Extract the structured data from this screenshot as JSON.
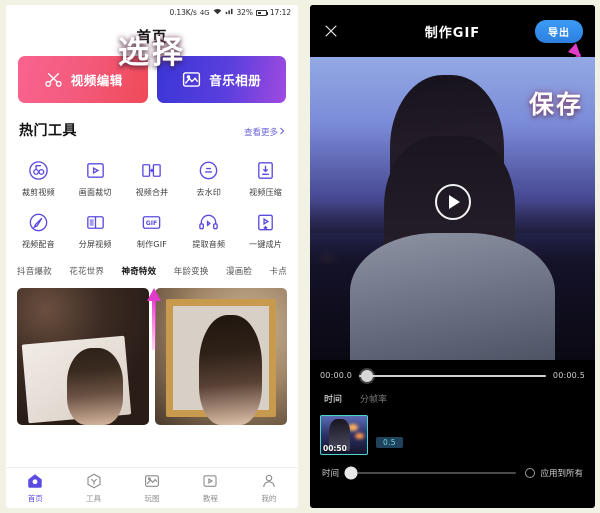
{
  "left_phone": {
    "status_bar": {
      "network_speed": "0.13K/s",
      "signal": "4G",
      "wifi_icon": "wifi-icon",
      "cell_icon": "signal-bars-icon",
      "battery_percent": "32%",
      "battery_icon": "battery-icon",
      "clock": "17:12"
    },
    "page_title": "首页",
    "hero_buttons": [
      {
        "label": "视频编辑",
        "icon": "scissors-icon",
        "color": "#f45b7e"
      },
      {
        "label": "音乐相册",
        "icon": "photo-icon",
        "color": "#5a3fdd"
      }
    ],
    "section": {
      "title": "热门工具",
      "more_label": "查看更多",
      "more_icon": "chevron-right-icon"
    },
    "tools": [
      {
        "label": "裁剪视频",
        "icon": "trim-video-icon"
      },
      {
        "label": "画面裁切",
        "icon": "crop-frame-icon"
      },
      {
        "label": "视频合并",
        "icon": "merge-video-icon"
      },
      {
        "label": "去水印",
        "icon": "remove-watermark-icon"
      },
      {
        "label": "视频压缩",
        "icon": "compress-video-icon"
      },
      {
        "label": "视频配音",
        "icon": "dubbing-icon"
      },
      {
        "label": "分屏视频",
        "icon": "split-screen-icon"
      },
      {
        "label": "制作GIF",
        "icon": "gif-icon"
      },
      {
        "label": "提取音频",
        "icon": "extract-audio-icon"
      },
      {
        "label": "一键成片",
        "icon": "one-tap-movie-icon"
      }
    ],
    "chips": [
      {
        "label": "抖音爆款",
        "active": false
      },
      {
        "label": "花花世界",
        "active": false
      },
      {
        "label": "神奇特效",
        "active": true
      },
      {
        "label": "年龄变换",
        "active": false
      },
      {
        "label": "漫画脸",
        "active": false
      },
      {
        "label": "卡点",
        "active": false
      }
    ],
    "annotation": "选择",
    "bottom_nav": [
      {
        "label": "首页",
        "icon": "home-icon",
        "active": true
      },
      {
        "label": "工具",
        "icon": "tools-icon",
        "active": false
      },
      {
        "label": "玩图",
        "icon": "photo-play-icon",
        "active": false
      },
      {
        "label": "教程",
        "icon": "tutorial-icon",
        "active": false
      },
      {
        "label": "我的",
        "icon": "user-icon",
        "active": false
      }
    ]
  },
  "right_phone": {
    "header": {
      "close_icon": "close-icon",
      "title": "制作GIF",
      "export_label": "导出"
    },
    "annotation": "保存",
    "play_icon": "play-icon",
    "timeline": {
      "start": "00:00.0",
      "end": "00:00.5"
    },
    "segment_tabs": [
      {
        "label": "时间",
        "active": true
      },
      {
        "label": "分帧率",
        "active": false
      }
    ],
    "thumbnail": {
      "duration": "00:50",
      "rate_badge": "0.5"
    },
    "controls": {
      "slider_label": "时间",
      "apply_all_label": "应用到所有",
      "apply_all_icon": "radio-unchecked-icon"
    }
  }
}
